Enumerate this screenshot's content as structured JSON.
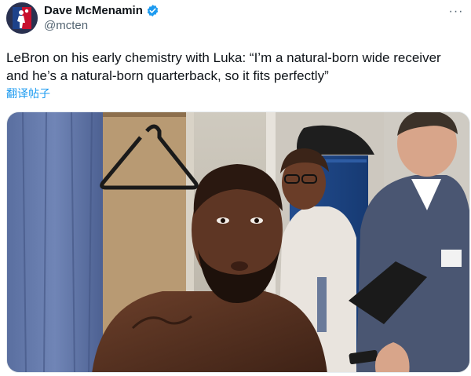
{
  "author": {
    "display_name": "Dave McMenamin",
    "handle": "@mcten",
    "verified": true,
    "avatar_icon": "avatar-nba-logo"
  },
  "tweet": {
    "text": "LeBron on his early chemistry with Luka: “I’m a natural-born wide receiver and he’s a natural-born quarterback, so it fits perfectly”",
    "translate_label": "翻译帖子",
    "more_label": "···"
  },
  "media": {
    "kind": "photo",
    "description_icon": "locker-room-photo"
  },
  "colors": {
    "link": "#1d9bf0",
    "verified": "#1d9bf0",
    "secondary_text": "#536471"
  }
}
